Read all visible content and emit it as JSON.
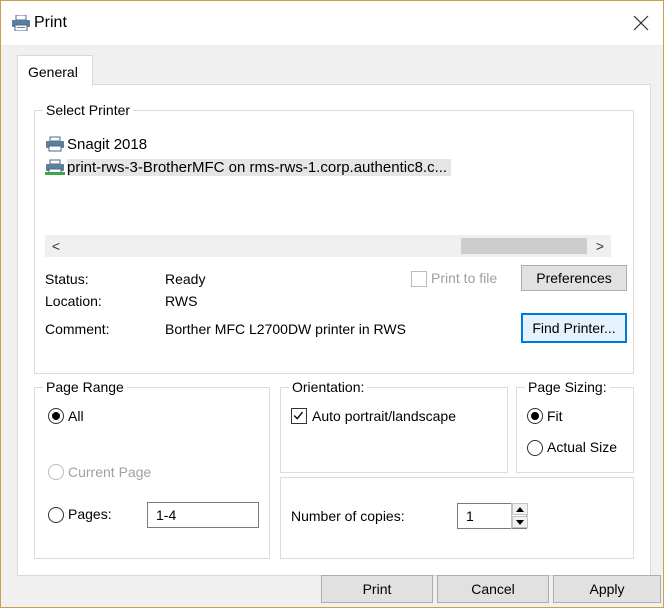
{
  "window": {
    "title": "Print",
    "close_icon": "close-icon",
    "app_icon": "printer-icon"
  },
  "tabs": [
    {
      "label": "General"
    }
  ],
  "select_printer": {
    "label": "Select Printer",
    "printers": [
      {
        "name": "Snagit 2018",
        "icon": "printer-icon",
        "selected": false
      },
      {
        "name": "print-rws-3-BrotherMFC on rms-rws-1.corp.authentic8.c...",
        "icon": "network-printer-icon",
        "selected": true
      }
    ],
    "scroll_left": "<",
    "scroll_right": ">",
    "status_label": "Status:",
    "status_value": "Ready",
    "location_label": "Location:",
    "location_value": "RWS",
    "comment_label": "Comment:",
    "comment_value": "Borther MFC L2700DW printer in RWS",
    "print_to_file_label": "Print to file",
    "print_to_file_checked": false,
    "preferences_button": "Preferences",
    "find_printer_button": "Find Printer..."
  },
  "page_range": {
    "label": "Page Range",
    "all_label": "All",
    "current_page_label": "Current Page",
    "pages_label": "Pages:",
    "pages_value": "1-4",
    "selected": "All"
  },
  "orientation": {
    "label": "Orientation:",
    "auto_label": "Auto portrait/landscape",
    "auto_checked": true
  },
  "page_sizing": {
    "label": "Page Sizing:",
    "fit_label": "Fit",
    "actual_size_label": "Actual Size",
    "selected": "Fit"
  },
  "copies": {
    "label": "Number of copies:",
    "value": "1"
  },
  "footer": {
    "print_button": "Print",
    "cancel_button": "Cancel",
    "apply_button": "Apply"
  },
  "colors": {
    "focus_border": "#0078d7",
    "window_border": "#c8a24a",
    "selection_bg": "#e5e5e5"
  }
}
